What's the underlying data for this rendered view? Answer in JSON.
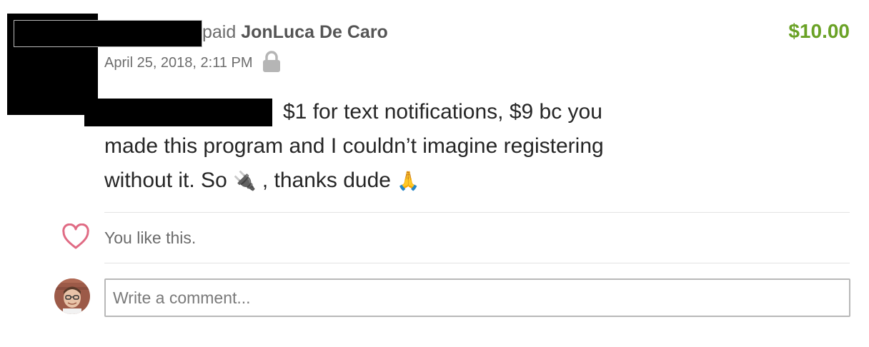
{
  "transaction": {
    "verb": "paid",
    "payee": "JonLuca De Caro",
    "amount": "$10.00",
    "date": "April 25, 2018, 2:11 PM",
    "message_line1": "$1 for text notifications, $9 bc you",
    "message_line2": "made this program and I couldn’t imagine registering",
    "message_line3_a": "without it. So",
    "message_emoji_plug": "🔌",
    "message_line3_b": ", thanks dude",
    "message_emoji_pray": "🙏"
  },
  "likes": {
    "text": "You like this."
  },
  "comment": {
    "placeholder": "Write a comment..."
  },
  "colors": {
    "amount": "#6aa226",
    "heart": "#e06b84",
    "lock": "#b5b5b5"
  },
  "icons": {
    "privacy": "lock-icon",
    "like": "heart-icon"
  }
}
